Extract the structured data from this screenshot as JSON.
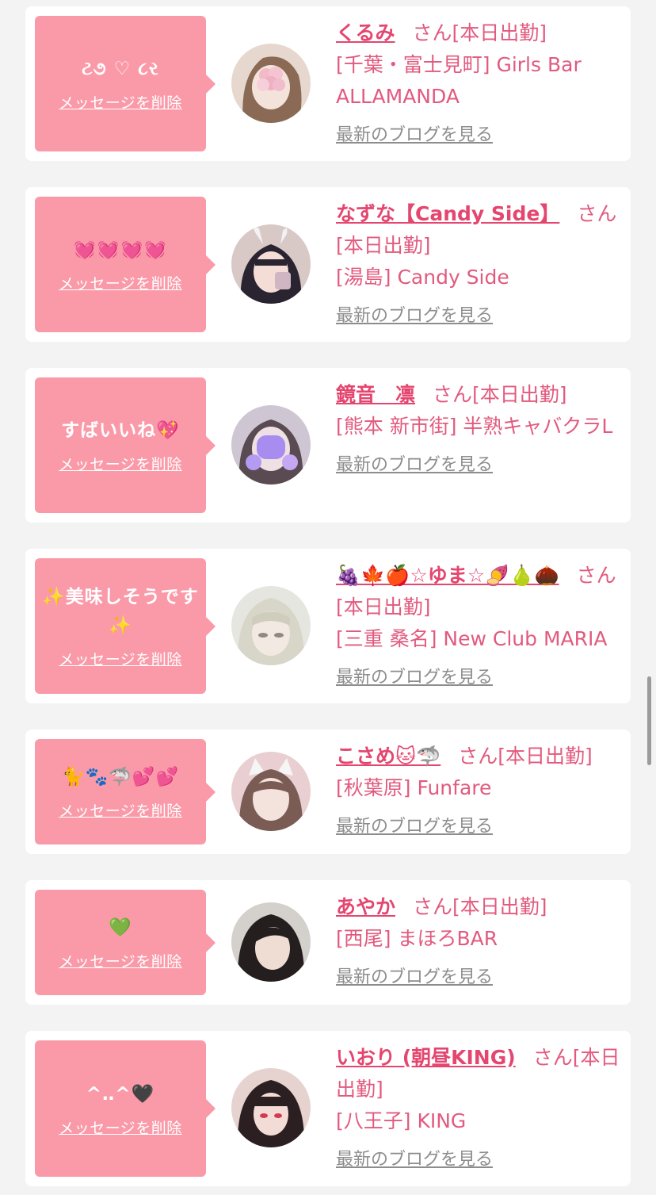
{
  "delete_label": "メッセージを削除",
  "blog_label": "最新のブログを見る",
  "colors": {
    "bubble": "#fa9aa9",
    "name": "#e4466f",
    "shop": "#e25a7e",
    "link": "#8d8d8d"
  },
  "cards": [
    {
      "message": "ટ૭ ♡ ૮ર",
      "name": "くるみ",
      "status": "さん[本日出勤]",
      "shop": "[千葉・富士見町] Girls Bar ALLAMANDA"
    },
    {
      "message": "💓💓💓💓",
      "name": "なずな【Candy Side】",
      "status": "さん[本日出勤]",
      "shop": "[湯島] Candy Side"
    },
    {
      "message": "すばいいね💖",
      "name": "鏡音　凛",
      "status": "さん[本日出勤]",
      "shop": "[熊本 新市街] 半熟キャバクラL"
    },
    {
      "message": "✨美味しそうです✨",
      "name": "🍇🍁🍎☆ゆま☆🍠🍐🌰",
      "status": "さん[本日出勤]",
      "shop": "[三重 桑名] New Club MARIA"
    },
    {
      "message": "🐈🐾🦈💕💕",
      "name": "こさめ🐱🦈",
      "status": "さん[本日出勤]",
      "shop": "[秋葉原] Funfare"
    },
    {
      "message": "💚",
      "name": "あやか",
      "status": "さん[本日出勤]",
      "shop": "[西尾] まほろBAR"
    },
    {
      "message": "^‥^🖤",
      "name": "いおり (朝昼KING)",
      "status": "さん[本日出勤]",
      "shop": "[八王子] KING"
    }
  ]
}
